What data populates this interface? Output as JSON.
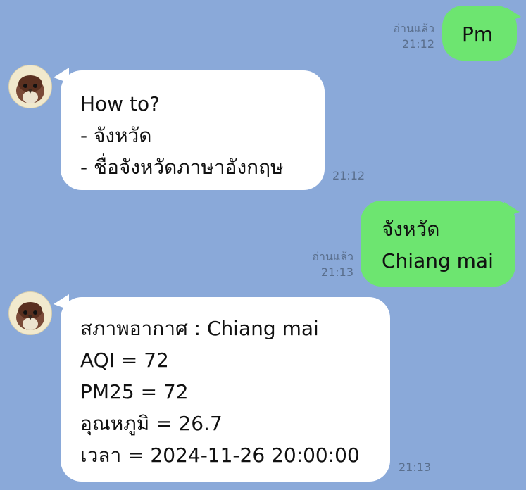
{
  "colors": {
    "background": "#8aa9d9",
    "outgoing_bubble": "#6de570",
    "incoming_bubble": "#ffffff",
    "meta_text": "#5a6f8d"
  },
  "messages": [
    {
      "direction": "outgoing",
      "read": "อ่านแล้ว",
      "time": "21:12",
      "lines": [
        "Pm"
      ]
    },
    {
      "direction": "incoming",
      "avatar_icon": "sparrow-avatar-icon",
      "time": "21:12",
      "lines": [
        "How to?",
        "- จังหวัด",
        "- ชื่อจังหวัดภาษาอังกฤษ"
      ]
    },
    {
      "direction": "outgoing",
      "read": "อ่านแล้ว",
      "time": "21:13",
      "lines": [
        "จังหวัด",
        "Chiang mai"
      ]
    },
    {
      "direction": "incoming",
      "avatar_icon": "sparrow-avatar-icon",
      "time": "21:13",
      "lines": [
        "สภาพอากาศ : Chiang mai",
        "AQI = 72",
        "PM25 = 72",
        "อุณหภูมิ = 26.7",
        "เวลา = 2024-11-26 20:00:00"
      ]
    }
  ]
}
